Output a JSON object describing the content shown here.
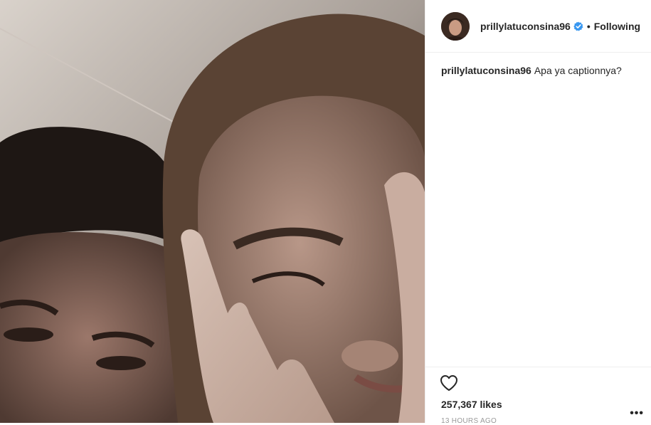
{
  "post": {
    "username": "prillylatuconsina96",
    "follow_status": "Following",
    "separator": "•",
    "caption_username": "prillylatuconsina96",
    "caption_text": "Apa ya captionnya?",
    "likes": "257,367 likes",
    "timestamp": "13 HOURS AGO",
    "more_label": "•••"
  },
  "colors": {
    "verified_blue": "#3897f0",
    "text": "#262626",
    "muted": "#999999",
    "border": "#efefef"
  },
  "icons": {
    "verified": "verified-badge-icon",
    "like": "heart-icon",
    "more": "more-options-icon"
  }
}
